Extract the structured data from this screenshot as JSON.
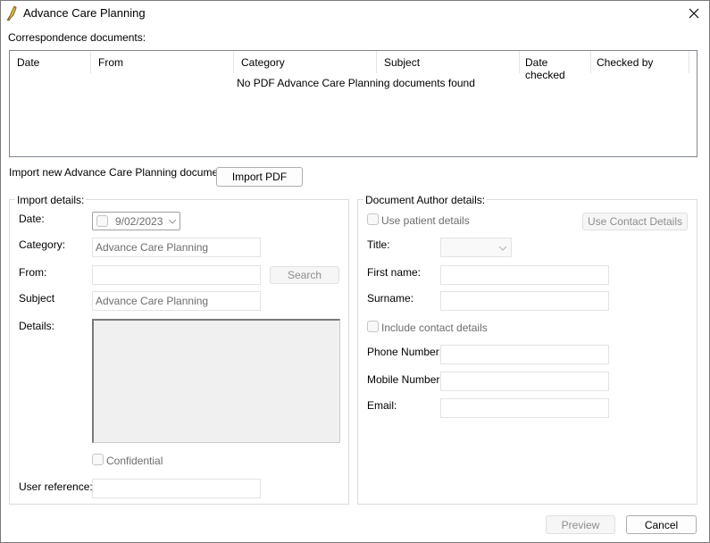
{
  "window": {
    "title": "Advance Care Planning",
    "app_icon": "bird-icon",
    "close_icon": "close-icon"
  },
  "correspondence": {
    "label": "Correspondence documents:",
    "columns": [
      "Date",
      "From",
      "Category",
      "Subject",
      "Date checked",
      "Checked by"
    ],
    "rows": [],
    "empty_message": "No PDF Advance Care Planning documents found"
  },
  "import_new": {
    "label": "Import new Advance Care Planning document",
    "button_label": "Import PDF"
  },
  "import_details": {
    "group_title": "Import details:",
    "date_label": "Date:",
    "date_checked": false,
    "date_value": "9/02/2023",
    "category_label": "Category:",
    "category_value": "Advance Care Planning",
    "from_label": "From:",
    "from_value": "",
    "search_button": "Search",
    "subject_label": "Subject",
    "subject_value": "Advance Care Planning",
    "details_label": "Details:",
    "details_value": "",
    "confidential_label": "Confidential",
    "confidential_checked": false,
    "user_reference_label": "User reference:",
    "user_reference_value": ""
  },
  "author_details": {
    "group_title": "Document Author details:",
    "use_patient_label": "Use patient details",
    "use_patient_checked": false,
    "use_contact_button": "Use Contact Details",
    "title_label": "Title:",
    "title_value": "",
    "first_name_label": "First name:",
    "first_name_value": "",
    "surname_label": "Surname:",
    "surname_value": "",
    "include_contact_label": "Include contact details",
    "include_contact_checked": false,
    "phone_label": "Phone Number:",
    "phone_value": "",
    "mobile_label": "Mobile Number:",
    "mobile_value": "",
    "email_label": "Email:",
    "email_value": ""
  },
  "footer": {
    "preview_button": "Preview",
    "cancel_button": "Cancel"
  }
}
